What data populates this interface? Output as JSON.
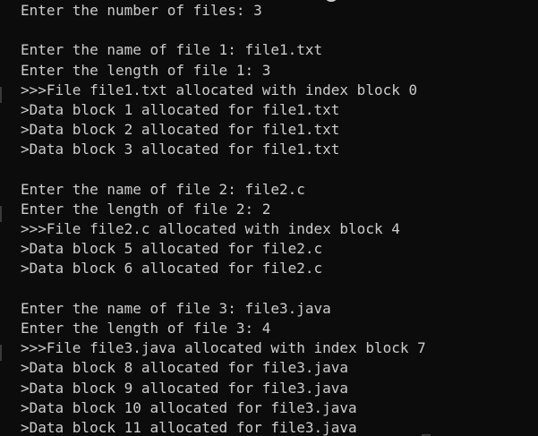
{
  "terminal": {
    "lines": [
      {
        "kind": "prompt",
        "text": "Enter the number of files: 3"
      },
      {
        "kind": "blank",
        "text": ""
      },
      {
        "kind": "prompt",
        "text": "Enter the name of file 1: file1.txt"
      },
      {
        "kind": "prompt",
        "text": "Enter the length of file 1: 3"
      },
      {
        "kind": "alloc",
        "text": ">>>File file1.txt allocated with index block 0"
      },
      {
        "kind": "data",
        "text": ">Data block 1 allocated for file1.txt"
      },
      {
        "kind": "data",
        "text": ">Data block 2 allocated for file1.txt"
      },
      {
        "kind": "data",
        "text": ">Data block 3 allocated for file1.txt"
      },
      {
        "kind": "blank",
        "text": ""
      },
      {
        "kind": "prompt",
        "text": "Enter the name of file 2: file2.c"
      },
      {
        "kind": "prompt",
        "text": "Enter the length of file 2: 2"
      },
      {
        "kind": "alloc",
        "text": ">>>File file2.c allocated with index block 4"
      },
      {
        "kind": "data",
        "text": ">Data block 5 allocated for file2.c"
      },
      {
        "kind": "data",
        "text": ">Data block 6 allocated for file2.c"
      },
      {
        "kind": "blank",
        "text": ""
      },
      {
        "kind": "prompt",
        "text": "Enter the name of file 3: file3.java"
      },
      {
        "kind": "prompt",
        "text": "Enter the length of file 3: 4"
      },
      {
        "kind": "alloc",
        "text": ">>>File file3.java allocated with index block 7"
      },
      {
        "kind": "data",
        "text": ">Data block 8 allocated for file3.java"
      },
      {
        "kind": "data",
        "text": ">Data block 9 allocated for file3.java"
      },
      {
        "kind": "data",
        "text": ">Data block 10 allocated for file3.java"
      },
      {
        "kind": "data",
        "text": ">Data block 11 allocated for file3.java"
      }
    ]
  },
  "colors": {
    "background": "#0c0c0c",
    "text": "#cccccc"
  }
}
